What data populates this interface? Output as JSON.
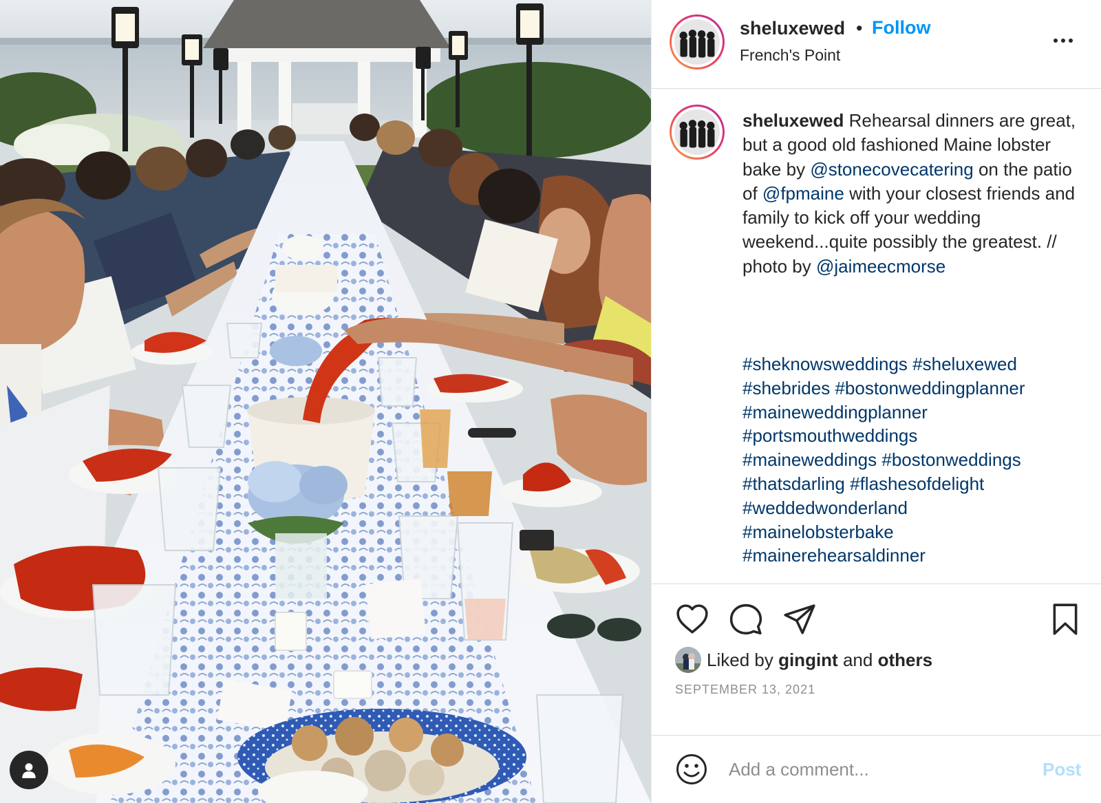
{
  "post": {
    "username": "sheluxewed",
    "separator": "•",
    "follow_label": "Follow",
    "location": "French's Point",
    "more_icon": "more-horizontal-icon"
  },
  "caption": {
    "username": "sheluxewed",
    "text_1": "Rehearsal dinners are great, but a good old fashioned Maine lobster bake by",
    "mention_1": "@stonecovecatering",
    "text_2": "on the patio of",
    "mention_2": "@fpmaine",
    "text_3": "with your closest friends and family to kick off your wedding weekend...quite possibly the greatest. // photo by",
    "mention_3": "@jaimeecmorse",
    "hashtags": [
      "#sheknowsweddings",
      "#sheluxewed",
      "#shebrides",
      "#bostonweddingplanner",
      "#maineweddingplanner",
      "#portsmouthweddings",
      "#maineweddings",
      "#bostonweddings",
      "#thatsdarling",
      "#flashesofdelight",
      "#weddedwonderland",
      "#mainelobsterbake",
      "#mainerehearsaldinner"
    ]
  },
  "actions": {
    "like_icon": "heart-icon",
    "comment_icon": "comment-icon",
    "share_icon": "paper-plane-icon",
    "save_icon": "bookmark-icon"
  },
  "likes": {
    "prefix": "Liked by",
    "user": "gingint",
    "conjunction": "and",
    "others": "others"
  },
  "date": "SEPTEMBER 13, 2021",
  "comment_box": {
    "placeholder": "Add a comment...",
    "post_label": "Post",
    "emoji_icon": "smiley-icon"
  },
  "colors": {
    "accent": "#0095f6",
    "link": "#00376b",
    "post_disabled": "#b2dffc",
    "muted": "#8e8e8e"
  }
}
